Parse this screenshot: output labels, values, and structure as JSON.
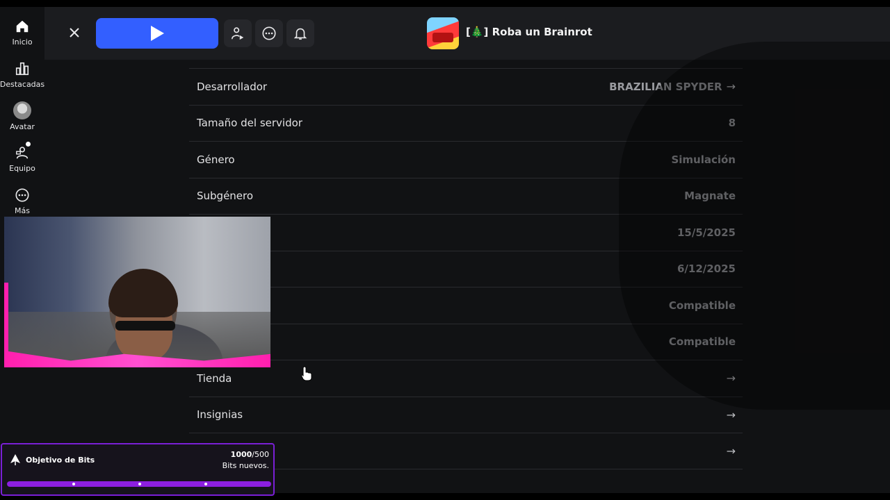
{
  "sidebar": {
    "items": [
      {
        "label": "Inicio",
        "icon": "home-icon"
      },
      {
        "label": "Destacadas",
        "icon": "charts-icon"
      },
      {
        "label": "Avatar",
        "icon": "avatar-icon"
      },
      {
        "label": "Equipo",
        "icon": "team-icon"
      },
      {
        "label": "Más",
        "icon": "more-icon"
      }
    ]
  },
  "header": {
    "game_title": "[🎄] Roba un Brainrot",
    "accent_color": "#335fff"
  },
  "info": {
    "rows": [
      {
        "label": "Desarrollador",
        "value": "BRAZILIAN SPYDER",
        "arrow": "→"
      },
      {
        "label": "Tamaño del servidor",
        "value": "8",
        "arrow": ""
      },
      {
        "label": "Género",
        "value": "Simulación",
        "arrow": ""
      },
      {
        "label": "Subgénero",
        "value": "Magnate",
        "arrow": ""
      },
      {
        "label": "",
        "value": "15/5/2025",
        "arrow": ""
      },
      {
        "label": "",
        "value": "6/12/2025",
        "arrow": ""
      },
      {
        "label": "",
        "value": "Compatible",
        "arrow": ""
      },
      {
        "label": "",
        "value": "Compatible",
        "arrow": ""
      },
      {
        "label": "Tienda",
        "value": "",
        "arrow": "→"
      },
      {
        "label": "Insignias",
        "value": "",
        "arrow": "→"
      },
      {
        "label": "",
        "value": "",
        "arrow": "→"
      }
    ]
  },
  "bits_goal": {
    "title": "Objetivo de Bits",
    "current": "1000",
    "target": "/500",
    "subtitle": "Bits nuevos.",
    "progress_fraction": 1.0,
    "color": "#8c1fe0"
  }
}
